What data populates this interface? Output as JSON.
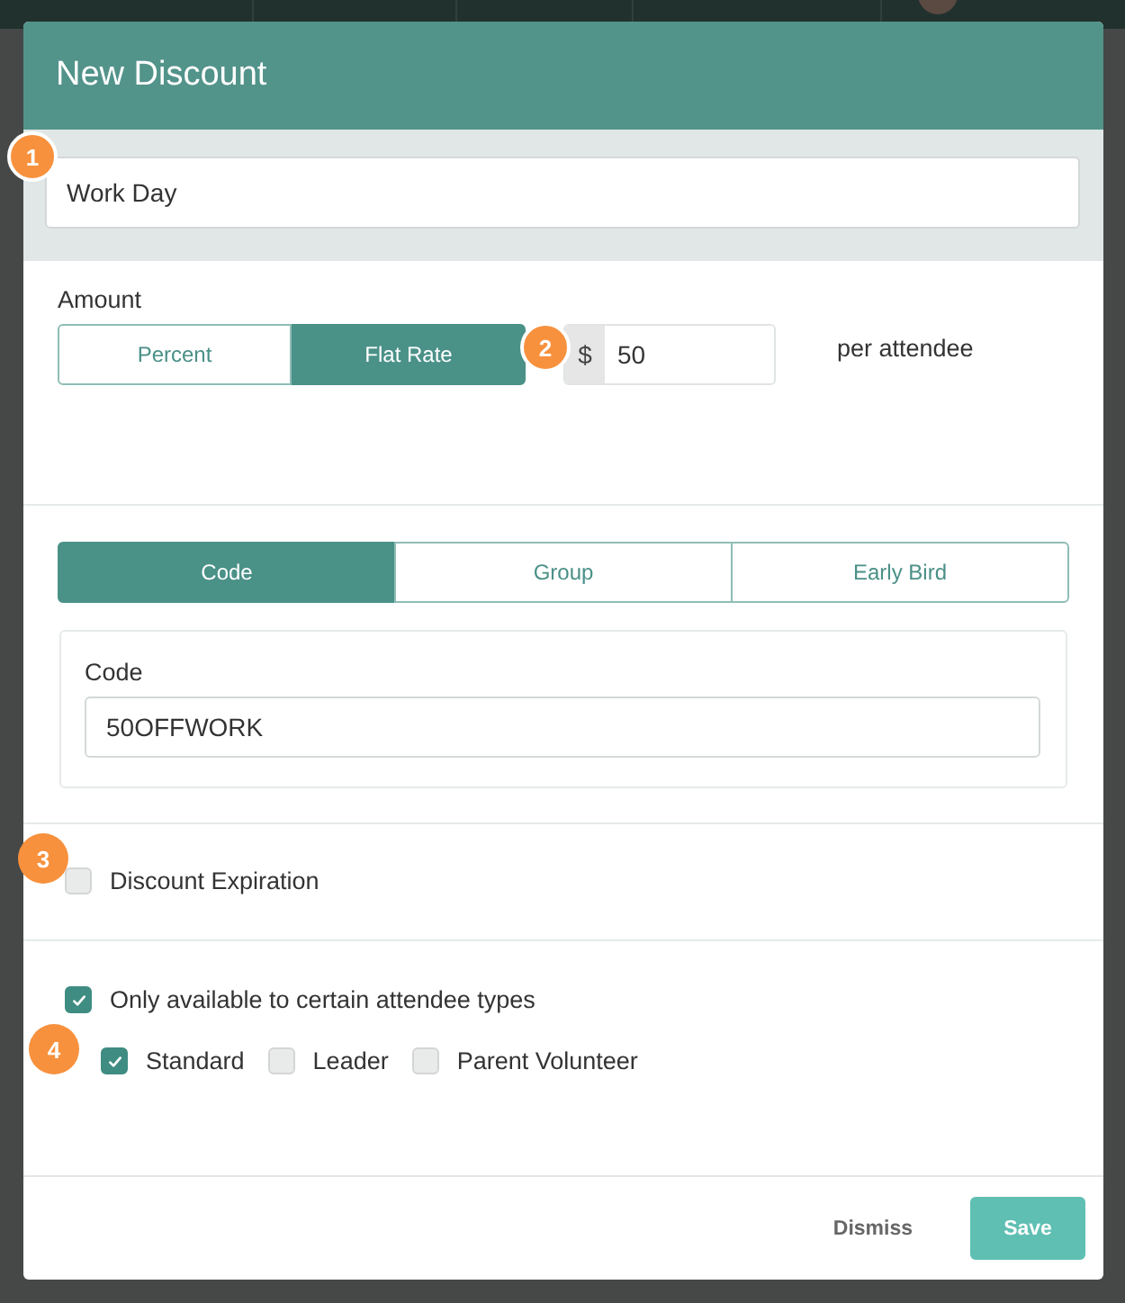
{
  "dialog": {
    "title": "New Discount"
  },
  "name_field": {
    "value": "Work Day",
    "badge": "1"
  },
  "amount": {
    "label": "Amount",
    "badge": "2",
    "modes": [
      {
        "label": "Percent",
        "selected": false
      },
      {
        "label": "Flat Rate",
        "selected": true
      }
    ],
    "prefix": "$",
    "value": "50",
    "suffix": "per attendee"
  },
  "discount_types": [
    {
      "label": "Code",
      "selected": true
    },
    {
      "label": "Group",
      "selected": false
    },
    {
      "label": "Early Bird",
      "selected": false
    }
  ],
  "code": {
    "label": "Code",
    "value": "50OFFWORK"
  },
  "expiration": {
    "label": "Discount Expiration",
    "checked": false,
    "badge": "3"
  },
  "attendee_types": {
    "label": "Only available to certain attendee types",
    "checked": true,
    "badge": "4",
    "options": [
      {
        "label": "Standard",
        "checked": true
      },
      {
        "label": "Leader",
        "checked": false
      },
      {
        "label": "Parent Volunteer",
        "checked": false
      }
    ]
  },
  "buttons": {
    "dismiss": "Dismiss",
    "save": "Save"
  }
}
